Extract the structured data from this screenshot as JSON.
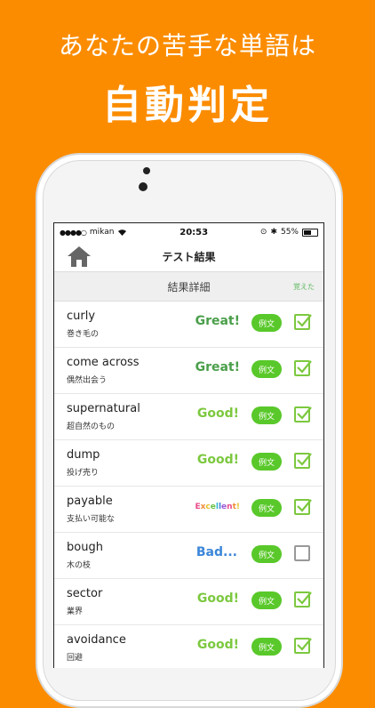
{
  "promo": {
    "line1": "あなたの苦手な単語は",
    "line2": "自動判定"
  },
  "status_bar": {
    "carrier": "mikan",
    "time": "20:53",
    "battery": "55%",
    "battery_level": 0.55
  },
  "nav": {
    "title": "テスト結果"
  },
  "section": {
    "title": "結果詳細",
    "learned_label": "覚えた"
  },
  "rows": [
    {
      "word": "curly",
      "meaning": "巻き毛の",
      "grade": "Great!",
      "example": "例文",
      "checked": true
    },
    {
      "word": "come across",
      "meaning": "偶然出会う",
      "grade": "Great!",
      "example": "例文",
      "checked": true
    },
    {
      "word": "supernatural",
      "meaning": "超自然のもの",
      "grade": "Good!",
      "example": "例文",
      "checked": true
    },
    {
      "word": "dump",
      "meaning": "投げ売り",
      "grade": "Good!",
      "example": "例文",
      "checked": true
    },
    {
      "word": "payable",
      "meaning": "支払い可能な",
      "grade": "Excellent!",
      "example": "例文",
      "checked": true
    },
    {
      "word": "bough",
      "meaning": "木の枝",
      "grade": "Bad...",
      "example": "例文",
      "checked": false
    },
    {
      "word": "sector",
      "meaning": "業界",
      "grade": "Good!",
      "example": "例文",
      "checked": true
    },
    {
      "word": "avoidance",
      "meaning": "回避",
      "grade": "Good!",
      "example": "例文",
      "checked": true
    }
  ],
  "colors": {
    "background": "#fb8c00",
    "accent_green": "#59c82a",
    "great": "#4a9f4a",
    "good": "#7cc83f",
    "bad": "#3b86d9"
  }
}
